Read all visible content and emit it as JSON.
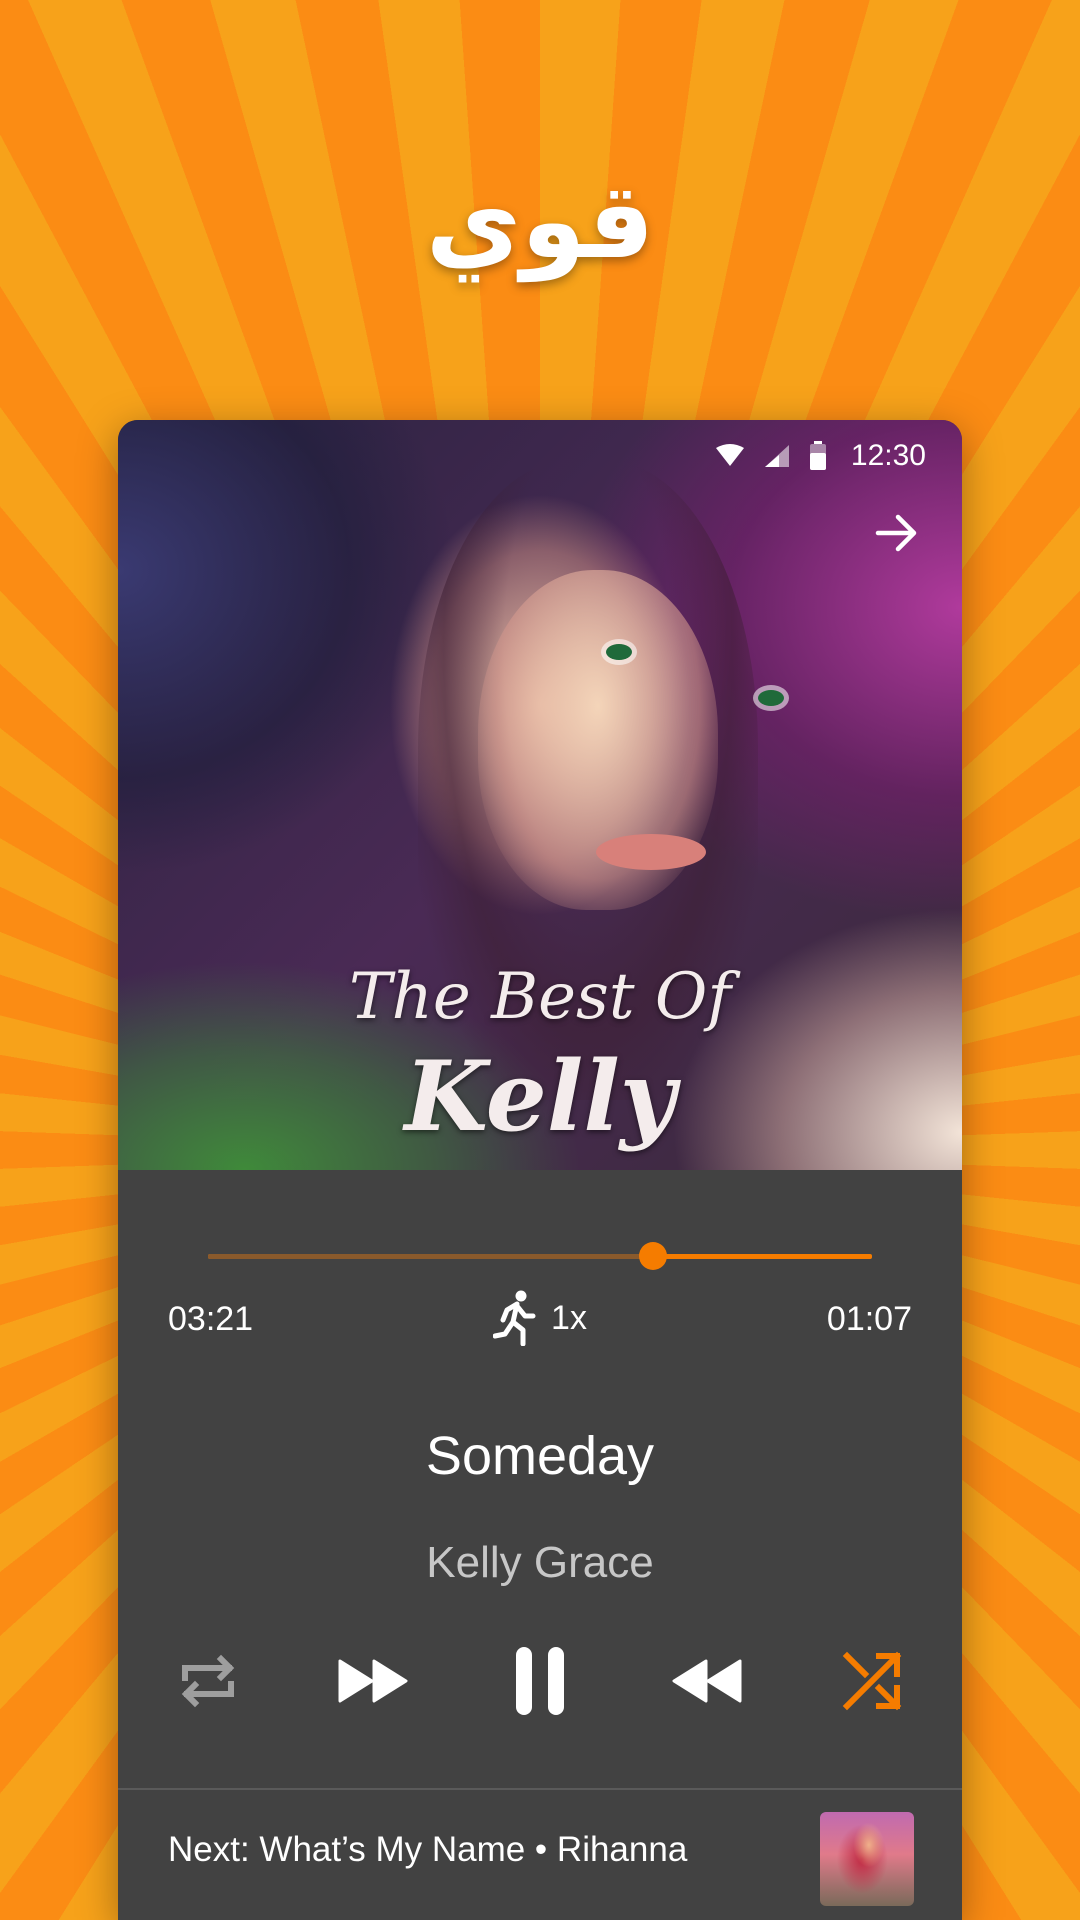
{
  "headline": "قوي",
  "status_bar": {
    "time": "12:30"
  },
  "album_art": {
    "line1": "The Best Of",
    "line2": "Kelly"
  },
  "player": {
    "elapsed": "03:21",
    "remaining": "01:07",
    "speed": "1x",
    "progress": 0.67,
    "song_title": "Someday",
    "artist": "Kelly Grace",
    "active_color": "#f57c00"
  },
  "next_up": {
    "label": "Next: What’s My Name • Rihanna"
  }
}
